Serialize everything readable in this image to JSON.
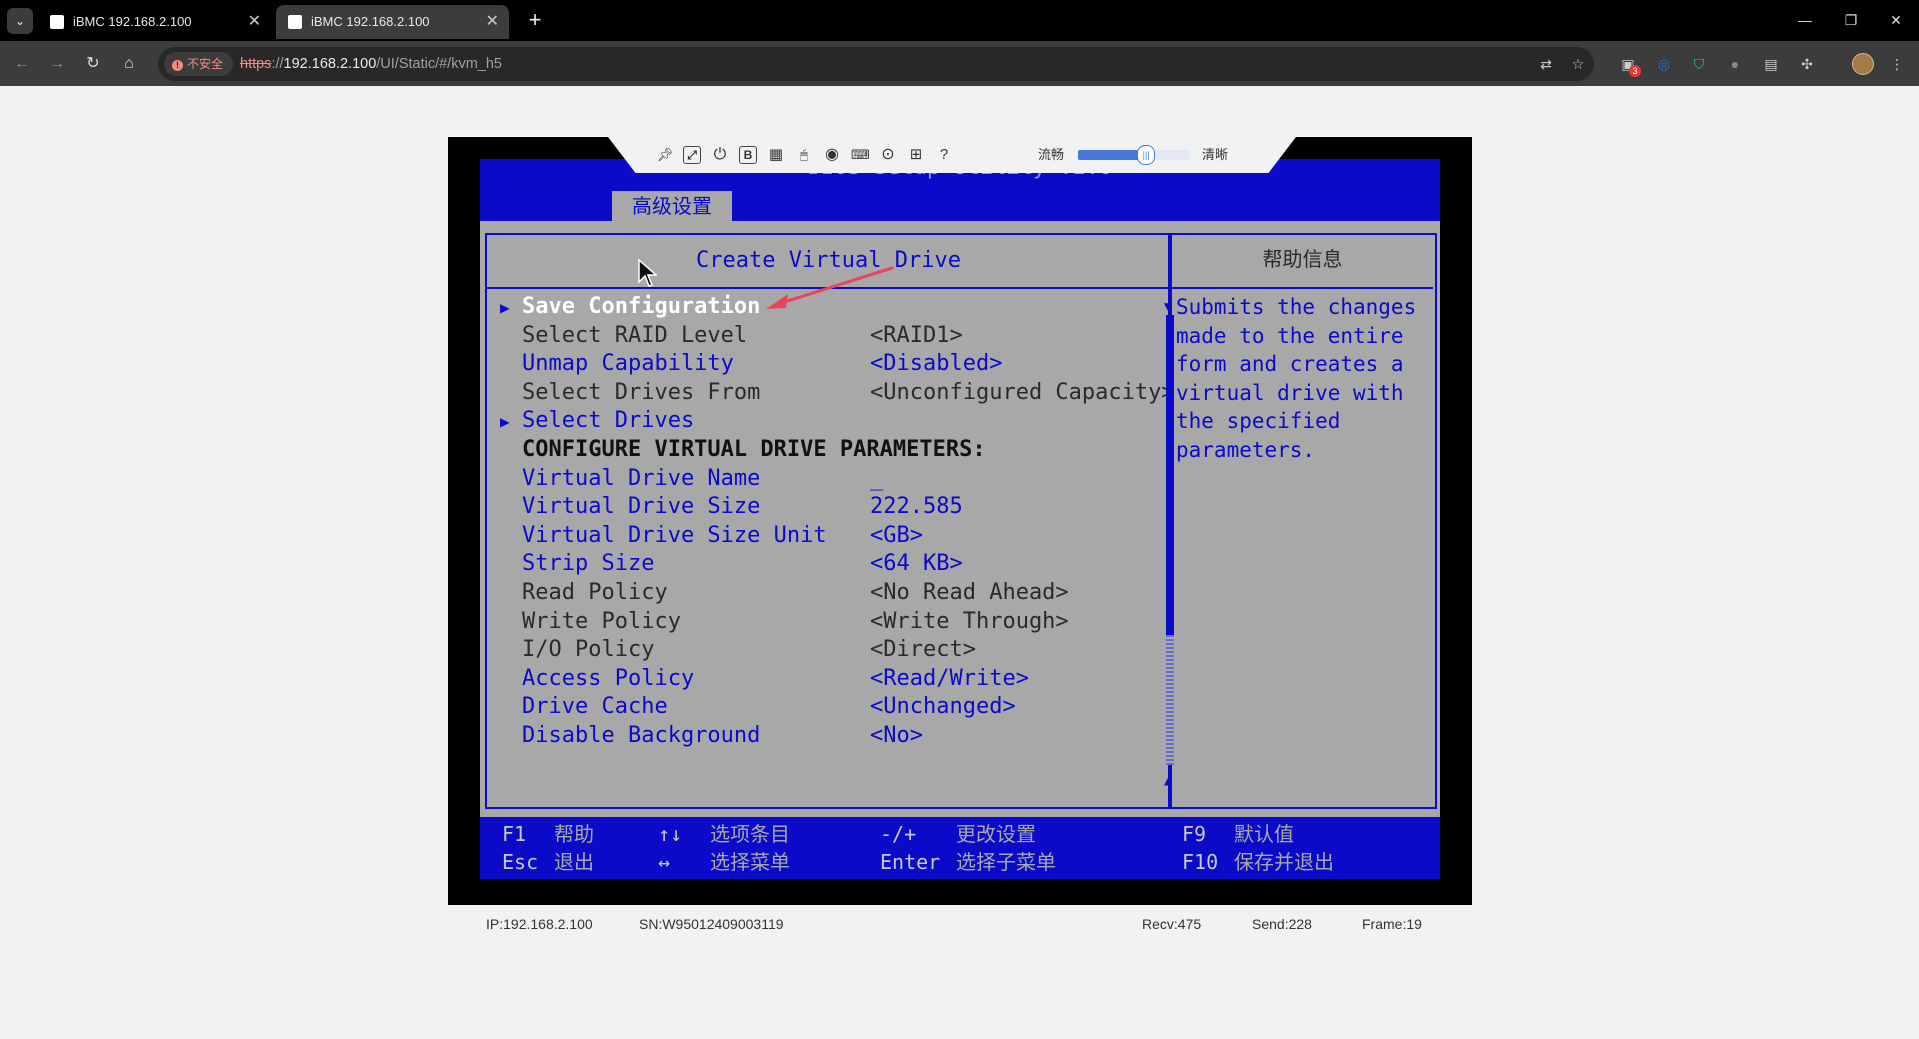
{
  "browser": {
    "tabs": [
      {
        "title": "iBMC 192.168.2.100",
        "close_glyph": "✕"
      },
      {
        "title": "iBMC 192.168.2.100",
        "close_glyph": "✕"
      }
    ],
    "active_tab": 1,
    "new_tab_glyph": "+",
    "security_label": "不安全",
    "url_scheme": "https",
    "url_sep": "://",
    "url_host": "192.168.2.100",
    "url_path": "/UI/Static/#/kvm_h5",
    "extension_badge": "3"
  },
  "kvm": {
    "toolbar_icons": [
      "pin-icon",
      "fullscreen-icon",
      "power-icon",
      "boot-icon",
      "image-icon",
      "mouse-icon",
      "disc-icon",
      "keyboard-macro-icon",
      "record-icon",
      "virtual-keyboard-icon",
      "help-icon"
    ],
    "quality_low_label": "流畅",
    "quality_high_label": "清晰",
    "quality_value": 0.6
  },
  "bios": {
    "title": "BIOS Setup Utility V2.0",
    "tab": "高级设置",
    "panel_title": "Create Virtual Drive",
    "help_title": "帮助信息",
    "items": [
      {
        "label": "Save Configuration",
        "value": "",
        "arrow": "▶",
        "style": "white"
      },
      {
        "label": "Select RAID Level",
        "value": "<RAID1>",
        "arrow": "",
        "style": "dark"
      },
      {
        "label": "Unmap Capability",
        "value": "<Disabled>",
        "arrow": "",
        "style": "blue"
      },
      {
        "label": "Select Drives From",
        "value": "<Unconfigured Capacity>",
        "arrow": "",
        "style": "dark"
      },
      {
        "label": "Select Drives",
        "value": "",
        "arrow": "▶",
        "style": "blue"
      },
      {
        "label": "CONFIGURE VIRTUAL DRIVE PARAMETERS:",
        "value": "",
        "arrow": "",
        "style": "black"
      },
      {
        "label": "Virtual Drive Name",
        "value": "_",
        "arrow": "",
        "style": "blue"
      },
      {
        "label": "Virtual Drive Size",
        "value": "222.585",
        "arrow": "",
        "style": "blue"
      },
      {
        "label": "Virtual Drive Size Unit",
        "value": "<GB>",
        "arrow": "",
        "style": "blue"
      },
      {
        "label": "Strip Size",
        "value": "<64 KB>",
        "arrow": "",
        "style": "blue"
      },
      {
        "label": "Read Policy",
        "value": "<No Read Ahead>",
        "arrow": "",
        "style": "dark"
      },
      {
        "label": "Write Policy",
        "value": "<Write Through>",
        "arrow": "",
        "style": "dark"
      },
      {
        "label": "I/O Policy",
        "value": "<Direct>",
        "arrow": "",
        "style": "dark"
      },
      {
        "label": "Access Policy",
        "value": "<Read/Write>",
        "arrow": "",
        "style": "blue"
      },
      {
        "label": "Drive Cache",
        "value": "<Unchanged>",
        "arrow": "",
        "style": "blue"
      },
      {
        "label": "Disable Background",
        "value": "<No>",
        "arrow": "",
        "style": "blue"
      }
    ],
    "help_lines": [
      "Submits the changes",
      "made to the entire",
      "form and creates a",
      "virtual drive with",
      "the specified",
      "parameters."
    ],
    "scroll_up": "▲",
    "scroll_down": "▼",
    "footer": [
      {
        "key": "F1",
        "desc": "帮助"
      },
      {
        "key": "Esc",
        "desc": "退出"
      },
      {
        "key": "↑↓",
        "desc": "选项条目"
      },
      {
        "key": "↔",
        "desc": "选择菜单"
      },
      {
        "key": "-/+",
        "desc": "更改设置"
      },
      {
        "key": "Enter",
        "desc": "选择子菜单"
      },
      {
        "key": "F9",
        "desc": "默认值"
      },
      {
        "key": "F10",
        "desc": "保存并退出"
      }
    ]
  },
  "status": {
    "ip": "IP:192.168.2.100",
    "sn": "SN:W95012409003119",
    "recv": "Recv:475",
    "send": "Send:228",
    "frame": "Frame:19"
  },
  "colors": {
    "bios_blue": "#0a0ac8",
    "bios_gray": "#a8a8a8",
    "annotation_red": "#e8455a"
  }
}
